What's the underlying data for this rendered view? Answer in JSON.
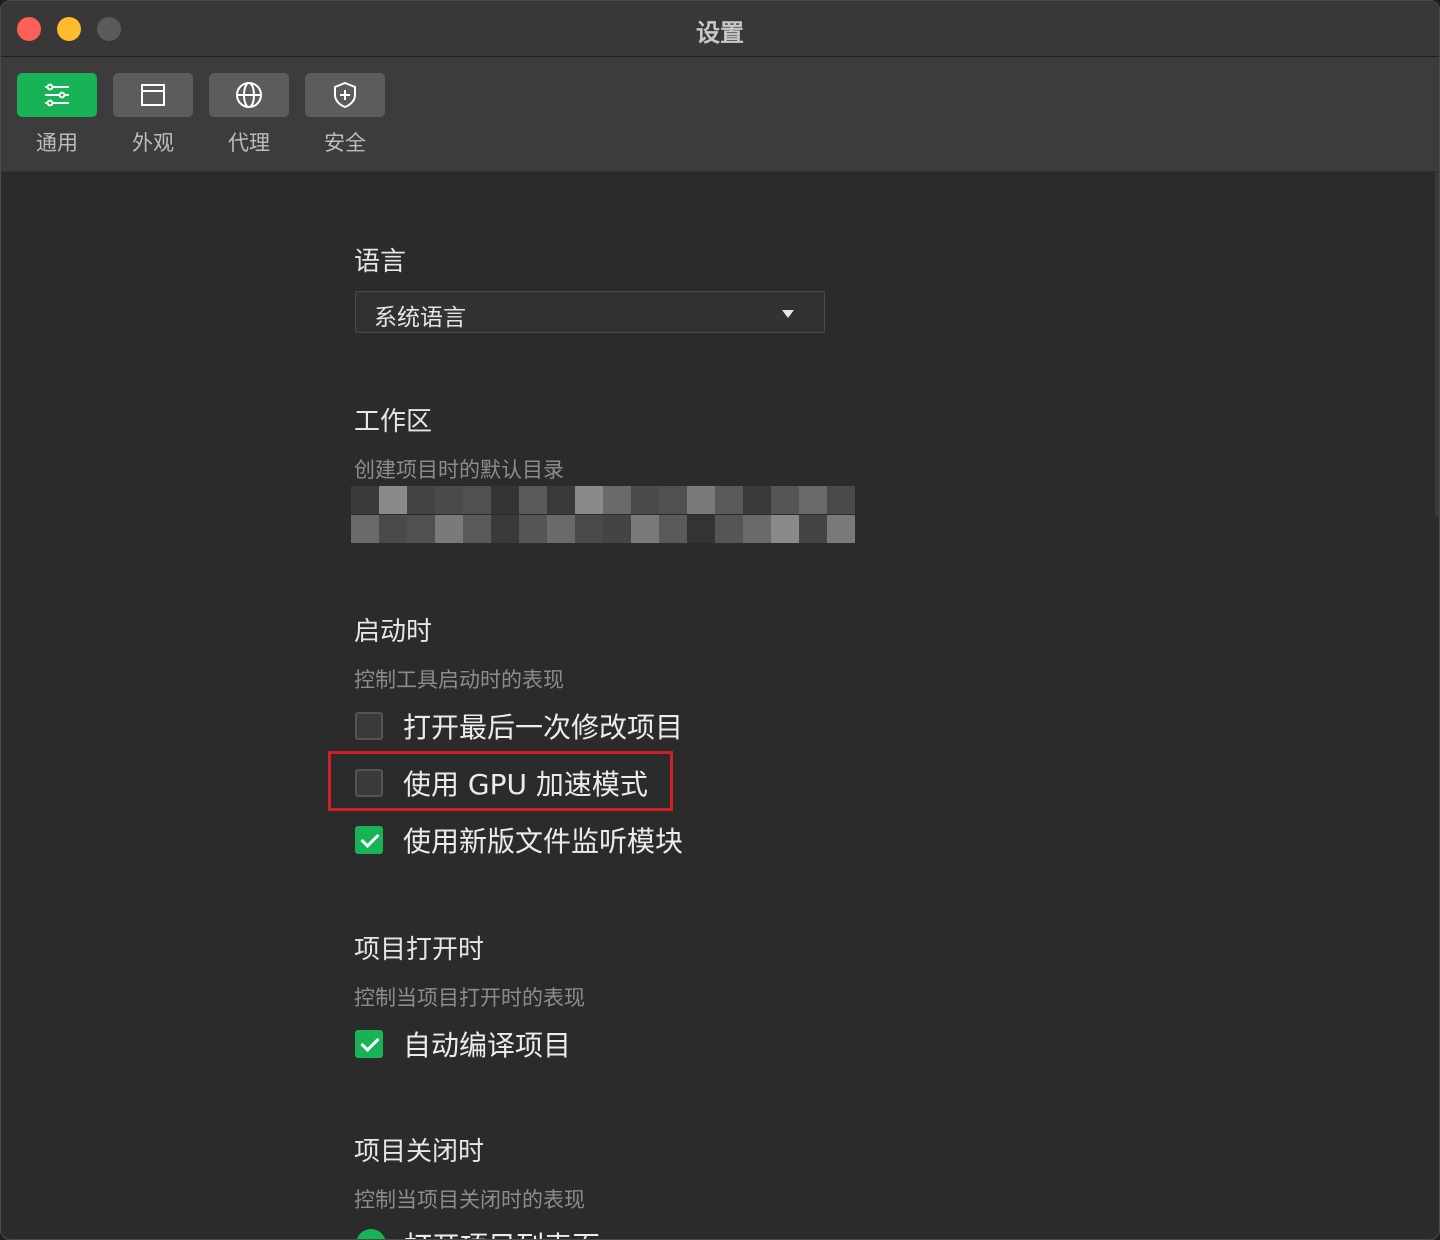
{
  "window": {
    "title": "设置"
  },
  "tabs": [
    {
      "label": "通用",
      "icon": "sliders-icon",
      "active": true
    },
    {
      "label": "外观",
      "icon": "window-icon",
      "active": false
    },
    {
      "label": "代理",
      "icon": "globe-icon",
      "active": false
    },
    {
      "label": "安全",
      "icon": "shield-icon",
      "active": false
    }
  ],
  "language": {
    "title": "语言",
    "selected": "系统语言"
  },
  "workspace": {
    "title": "工作区",
    "description": "创建项目时的默认目录"
  },
  "startup": {
    "title": "启动时",
    "description": "控制工具启动时的表现",
    "options": [
      {
        "label": "打开最后一次修改项目",
        "checked": false
      },
      {
        "label": "使用 GPU 加速模式",
        "checked": false,
        "highlighted": true
      },
      {
        "label": "使用新版文件监听模块",
        "checked": true
      }
    ]
  },
  "project_open": {
    "title": "项目打开时",
    "description": "控制当项目打开时的表现",
    "options": [
      {
        "label": "自动编译项目",
        "checked": true
      }
    ]
  },
  "project_close": {
    "title": "项目关闭时",
    "description": "控制当项目关闭时的表现",
    "options": [
      {
        "label": "打开项目列表页",
        "selected": true
      }
    ]
  },
  "colors": {
    "accent": "#18b356",
    "highlight_border": "#d21f26",
    "background": "#2b2b2b"
  }
}
